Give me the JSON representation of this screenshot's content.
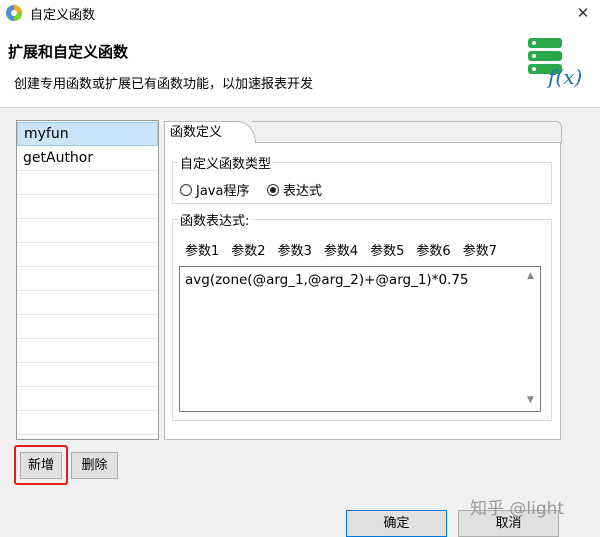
{
  "window": {
    "title": "自定义函数",
    "close_glyph": "✕"
  },
  "header": {
    "title": "扩展和自定义函数",
    "subtitle": "创建专用函数或扩展已有函数功能，以加速报表开发",
    "logo_text": "f(x)"
  },
  "functions_list": {
    "items": [
      "myfun",
      "getAuthor"
    ],
    "selected": "myfun"
  },
  "tab": {
    "label": "函数定义"
  },
  "type_group": {
    "label": "自定义函数类型",
    "options": [
      {
        "label": "Java程序",
        "checked": false
      },
      {
        "label": "表达式",
        "checked": true
      }
    ]
  },
  "expr_group": {
    "label": "函数表达式:",
    "params": [
      "参数1",
      "参数2",
      "参数3",
      "参数4",
      "参数5",
      "参数6",
      "参数7"
    ],
    "value": "avg(zone(@arg_1,@arg_2)+@arg_1)*0.75"
  },
  "buttons": {
    "add": "新增",
    "delete": "删除",
    "ok": "确定",
    "cancel": "取消"
  },
  "watermark": "知乎 @light",
  "colors": {
    "selection": "#cce4f7",
    "highlight": "#e01e1e",
    "accent": "#2aa94a"
  }
}
